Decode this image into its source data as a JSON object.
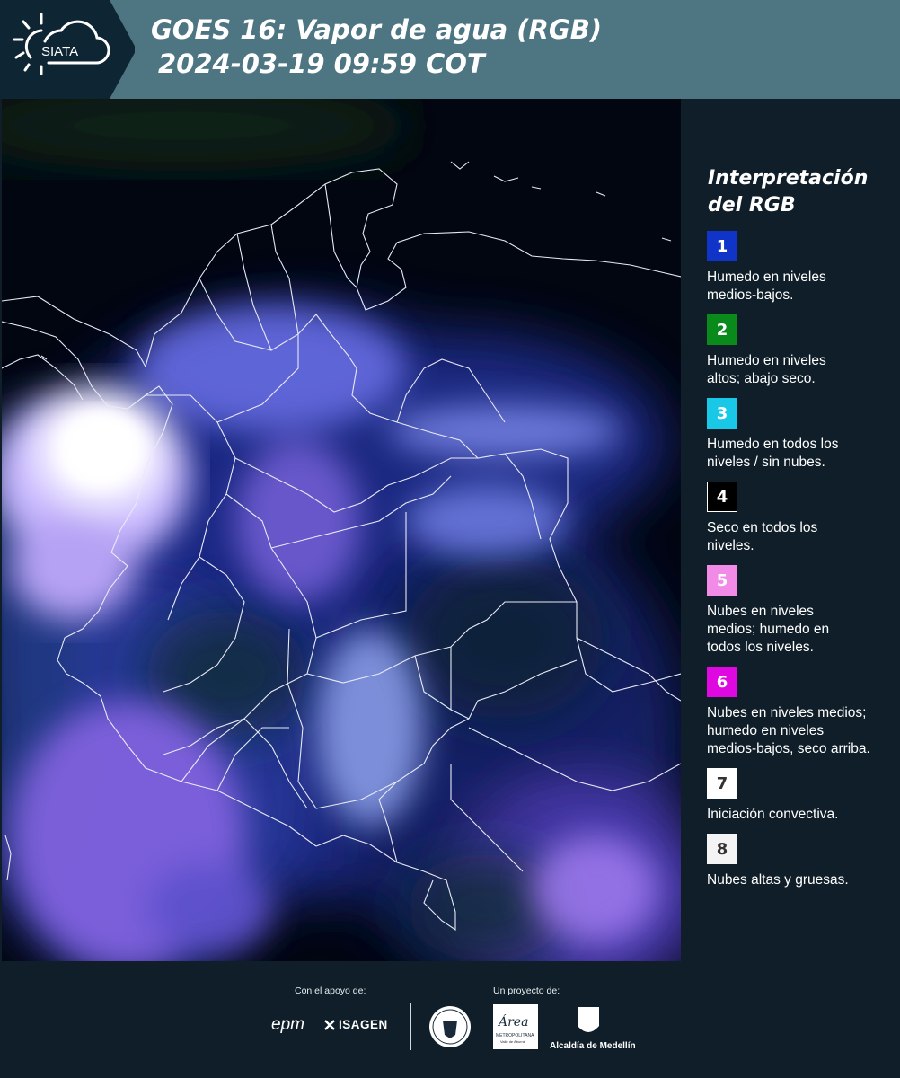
{
  "header": {
    "brand": "SIATA",
    "title_line1": "GOES 16: Vapor de agua (RGB)",
    "title_line2": "2024-03-19 09:59 COT"
  },
  "legend": {
    "title_line1": "Interpretación",
    "title_line2": "del RGB",
    "items": [
      {
        "num": "1",
        "color": "#1033c8",
        "text_color": "#ffffff",
        "line1": "Humedo en niveles",
        "line2": "medios-bajos.",
        "line3": ""
      },
      {
        "num": "2",
        "color": "#0b8a1c",
        "text_color": "#ffffff",
        "line1": "Humedo en niveles",
        "line2": "altos; abajo seco.",
        "line3": ""
      },
      {
        "num": "3",
        "color": "#19c7e6",
        "text_color": "#ffffff",
        "line1": "Humedo en todos los",
        "line2": "niveles / sin nubes.",
        "line3": ""
      },
      {
        "num": "4",
        "color": "#000000",
        "text_color": "#ffffff",
        "line1": "Seco en todos los",
        "line2": "niveles.",
        "line3": ""
      },
      {
        "num": "5",
        "color": "#f28be8",
        "text_color": "#ffffff",
        "line1": "Nubes en niveles",
        "line2": "medios; humedo en",
        "line3": "todos los niveles."
      },
      {
        "num": "6",
        "color": "#df08e0",
        "text_color": "#ffffff",
        "line1": "Nubes en niveles medios;",
        "line2": "humedo en niveles",
        "line3": "medios-bajos, seco arriba."
      },
      {
        "num": "7",
        "color": "#ffffff",
        "text_color": "#333333",
        "line1": "Iniciación convectiva.",
        "line2": "",
        "line3": ""
      },
      {
        "num": "8",
        "color": "#f4f4f4",
        "text_color": "#333333",
        "line1": "Nubes altas y gruesas.",
        "line2": "",
        "line3": ""
      }
    ]
  },
  "footer": {
    "support_label": "Con el apoyo de:",
    "project_label": "Un proyecto de:",
    "sponsor1": "epm",
    "sponsor2": "ISAGEN",
    "logo3_name": "Área Metropolitana",
    "logo3_line1": "Área",
    "logo3_line2": "METROPOLITANA",
    "logo3_line3": "Valle de Aburrá",
    "logo4": "Alcaldía de Medellín"
  }
}
